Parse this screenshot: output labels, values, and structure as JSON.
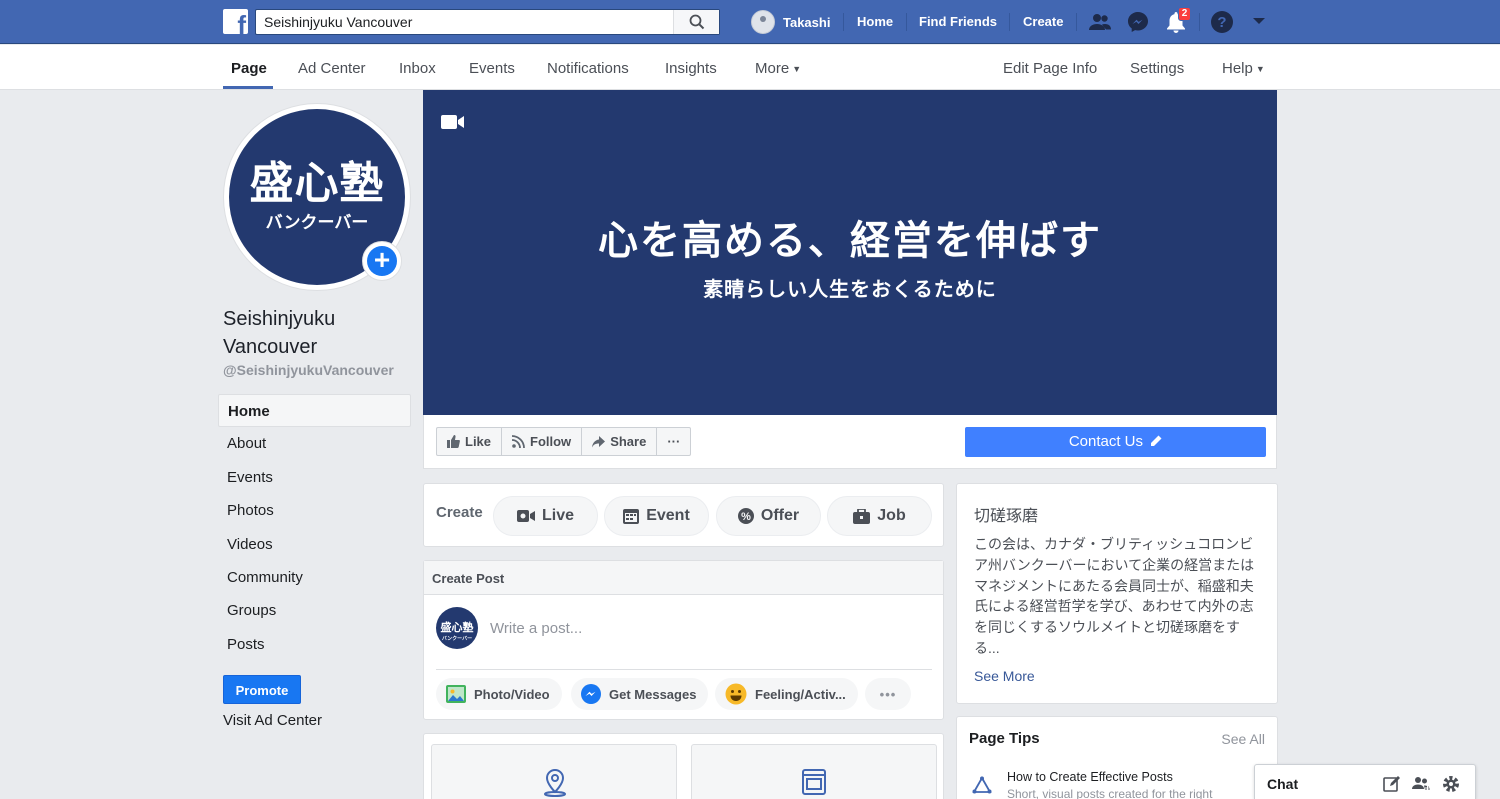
{
  "topbar": {
    "search_value": "Seishinjyuku Vancouver",
    "user_name": "Takashi",
    "home": "Home",
    "find_friends": "Find Friends",
    "create": "Create",
    "notification_count": "2"
  },
  "page_nav": {
    "items": [
      "Page",
      "Ad Center",
      "Inbox",
      "Events",
      "Notifications",
      "Insights",
      "More"
    ],
    "right_items": [
      "Edit Page Info",
      "Settings",
      "Help"
    ]
  },
  "profile": {
    "logo_kanji": "盛心塾",
    "logo_kana": "バンクーバー",
    "name": "Seishinjyuku Vancouver",
    "handle": "@SeishinjyukuVancouver"
  },
  "side_nav": [
    "Home",
    "About",
    "Events",
    "Photos",
    "Videos",
    "Community",
    "Groups",
    "Posts"
  ],
  "promote": {
    "button": "Promote",
    "visit": "Visit Ad Center"
  },
  "cover": {
    "title": "心を高める、経営を伸ばす",
    "subtitle": "素晴らしい人生をおくるために"
  },
  "actions": {
    "like": "Like",
    "follow": "Follow",
    "share": "Share",
    "more": "···",
    "contact": "Contact Us"
  },
  "create_bar": {
    "label": "Create",
    "live": "Live",
    "event": "Event",
    "offer": "Offer",
    "job": "Job"
  },
  "create_post": {
    "header": "Create Post",
    "placeholder": "Write a post...",
    "photo_video": "Photo/Video",
    "get_messages": "Get Messages",
    "feeling": "Feeling/Activ...",
    "more": "•••"
  },
  "about": {
    "title": "切磋琢磨",
    "text": "この会は、カナダ・ブリティッシュコロンビア州バンクーバーにおいて企業の経営またはマネジメントにあたる会員同士が、稲盛和夫氏による経営哲学を学び、あわせて内外の志を同じくするソウルメイトと切磋琢磨をする...",
    "see_more": "See More"
  },
  "page_tips": {
    "title": "Page Tips",
    "see_all": "See All",
    "tip_title": "How to Create Effective Posts",
    "tip_sub": "Short, visual posts created for the right"
  },
  "chat": {
    "label": "Chat"
  },
  "colors": {
    "facebook_blue": "#4267b2",
    "navy": "#23396f",
    "button_blue": "#4080ff"
  }
}
